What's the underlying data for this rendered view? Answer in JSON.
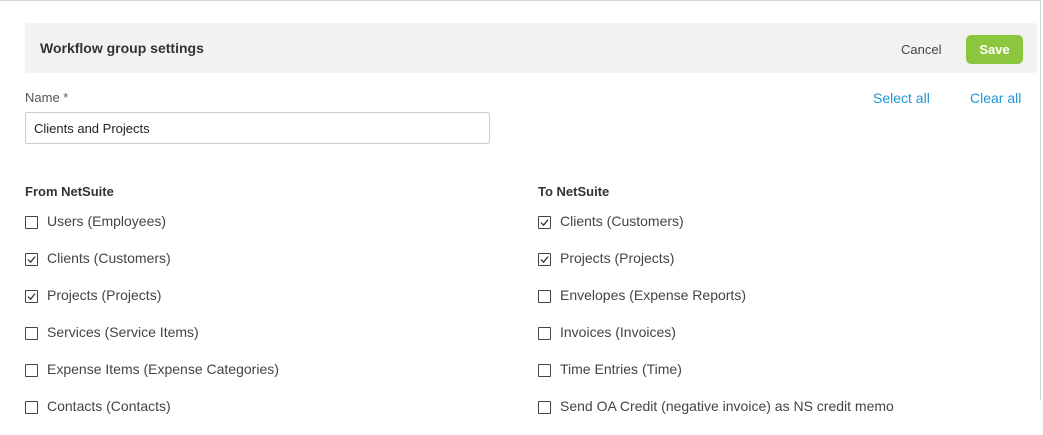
{
  "header": {
    "title": "Workflow group settings",
    "cancel_label": "Cancel",
    "save_label": "Save"
  },
  "form": {
    "name_label": "Name *",
    "name_value": "Clients and Projects",
    "select_all_label": "Select all",
    "clear_all_label": "Clear all"
  },
  "from_netsuite": {
    "heading": "From NetSuite",
    "items": [
      {
        "label": "Users (Employees)",
        "checked": false
      },
      {
        "label": "Clients (Customers)",
        "checked": true
      },
      {
        "label": "Projects (Projects)",
        "checked": true
      },
      {
        "label": "Services (Service Items)",
        "checked": false
      },
      {
        "label": "Expense Items (Expense Categories)",
        "checked": false
      },
      {
        "label": "Contacts (Contacts)",
        "checked": false
      }
    ]
  },
  "to_netsuite": {
    "heading": "To NetSuite",
    "items": [
      {
        "label": "Clients (Customers)",
        "checked": true
      },
      {
        "label": "Projects (Projects)",
        "checked": true
      },
      {
        "label": "Envelopes (Expense Reports)",
        "checked": false
      },
      {
        "label": "Invoices (Invoices)",
        "checked": false
      },
      {
        "label": "Time Entries (Time)",
        "checked": false
      },
      {
        "label": "Send OA Credit (negative invoice) as NS credit memo",
        "checked": false
      }
    ]
  },
  "colors": {
    "save_button": "#8cc63f",
    "link": "#1f97d4",
    "header_bg": "#f2f2f2"
  }
}
